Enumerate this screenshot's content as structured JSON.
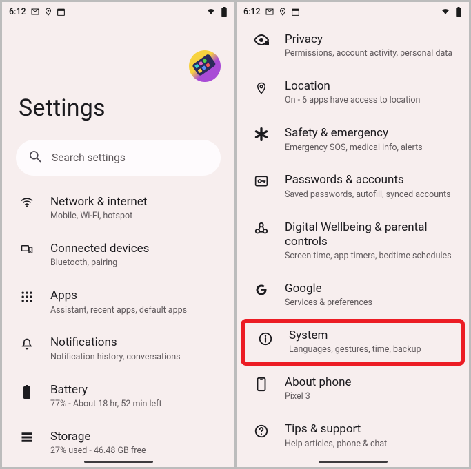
{
  "status": {
    "time": "6:12",
    "icons_left": [
      "gmail-icon",
      "location-pin-icon",
      "calendar-today-icon"
    ],
    "icons_right": [
      "wifi-icon",
      "battery-icon"
    ]
  },
  "header": {
    "title": "Settings"
  },
  "search": {
    "placeholder": "Search settings"
  },
  "left_items": [
    {
      "icon": "wifi-icon",
      "title": "Network & internet",
      "sub": "Mobile, Wi-Fi, hotspot"
    },
    {
      "icon": "devices-icon",
      "title": "Connected devices",
      "sub": "Bluetooth, pairing"
    },
    {
      "icon": "apps-grid-icon",
      "title": "Apps",
      "sub": "Assistant, recent apps, default apps"
    },
    {
      "icon": "bell-icon",
      "title": "Notifications",
      "sub": "Notification history, conversations"
    },
    {
      "icon": "battery-icon",
      "title": "Battery",
      "sub": "77% - About 18 hr, 52 min left"
    },
    {
      "icon": "storage-icon",
      "title": "Storage",
      "sub": "27% used - 46.48 GB free"
    }
  ],
  "right_items": [
    {
      "icon": "privacy-eye-icon",
      "title": "Privacy",
      "sub": "Permissions, account activity, personal data"
    },
    {
      "icon": "location-pin-icon",
      "title": "Location",
      "sub": "On - 6 apps have access to location"
    },
    {
      "icon": "asterisk-icon",
      "title": "Safety & emergency",
      "sub": "Emergency SOS, medical info, alerts"
    },
    {
      "icon": "key-account-icon",
      "title": "Passwords & accounts",
      "sub": "Saved passwords, autofill, synced accounts"
    },
    {
      "icon": "wellbeing-icon",
      "title": "Digital Wellbeing & parental controls",
      "sub": "Screen time, app timers, bedtime schedules"
    },
    {
      "icon": "google-g-icon",
      "title": "Google",
      "sub": "Services & preferences"
    },
    {
      "icon": "info-icon",
      "title": "System",
      "sub": "Languages, gestures, time, backup",
      "highlight": true
    },
    {
      "icon": "phone-device-icon",
      "title": "About phone",
      "sub": "Pixel 3"
    },
    {
      "icon": "help-icon",
      "title": "Tips & support",
      "sub": "Help articles, phone & chat"
    }
  ]
}
